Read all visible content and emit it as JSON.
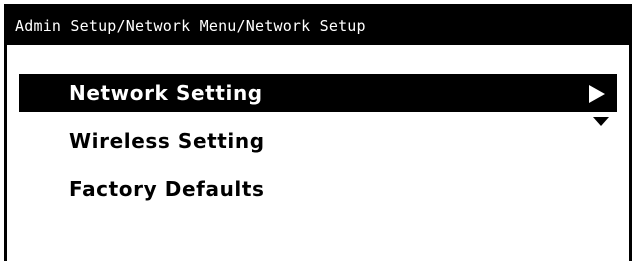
{
  "header": {
    "breadcrumb": "Admin Setup/Network Menu/Network Setup"
  },
  "menu": {
    "items": [
      {
        "label": "Network Setting",
        "selected": true,
        "has_submenu": true
      },
      {
        "label": "Wireless Setting",
        "selected": false
      },
      {
        "label": "Factory Defaults",
        "selected": false
      }
    ]
  },
  "indicators": {
    "submenu_arrow_icon": "right-triangle",
    "scroll_down_icon": "down-triangle"
  }
}
